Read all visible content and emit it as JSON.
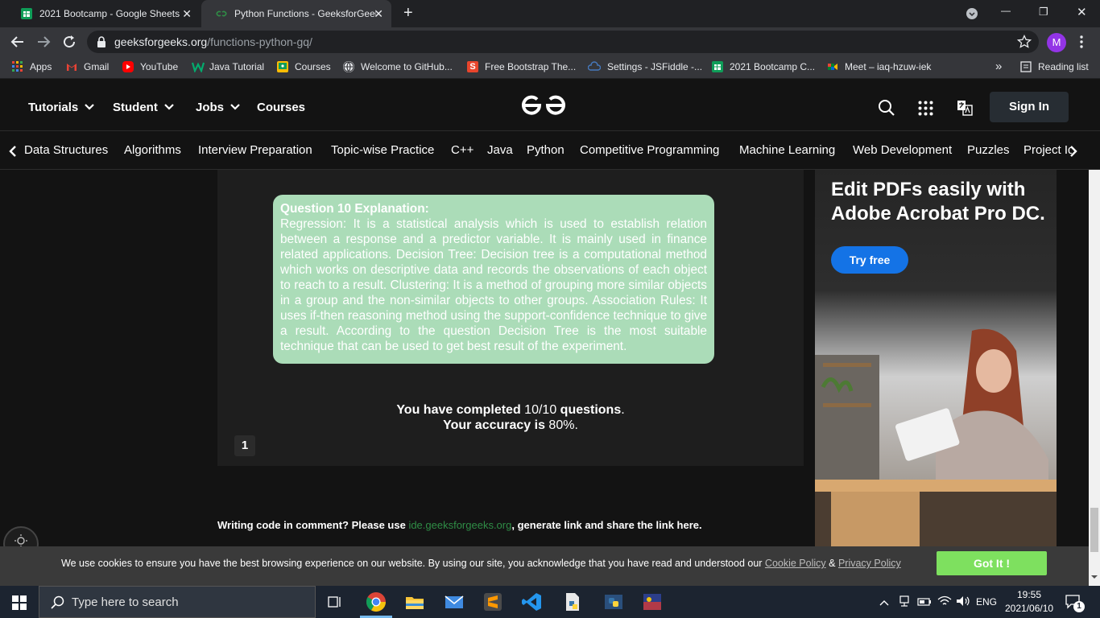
{
  "browser": {
    "tabs": [
      {
        "title": "2021 Bootcamp - Google Sheets",
        "close": "✕"
      },
      {
        "title": "Python Functions - GeeksforGeeks",
        "close": "✕"
      }
    ],
    "new_tab": "+",
    "window_controls": {
      "minimize": "—",
      "maximize": "❐",
      "close": "✕"
    },
    "url_domain": "geeksforgeeks.org",
    "url_path": "/functions-python-gq/",
    "profile_initial": "M",
    "bookmarks": [
      "Apps",
      "Gmail",
      "YouTube",
      "Java Tutorial",
      "Courses",
      "Welcome to GitHub...",
      "Free Bootstrap The...",
      "Settings - JSFiddle -...",
      "2021 Bootcamp C...",
      "Meet – iaq-hzuw-iek"
    ],
    "bookmarks_overflow": "»",
    "reading_list": "Reading list"
  },
  "site": {
    "nav": [
      "Tutorials",
      "Student",
      "Jobs",
      "Courses"
    ],
    "logo": "GG",
    "sign_in": "Sign In",
    "subnav": [
      "Data Structures",
      "Algorithms",
      "Interview Preparation",
      "Topic-wise Practice",
      "C++",
      "Java",
      "Python",
      "Competitive Programming",
      "Machine Learning",
      "Web Development",
      "Puzzles",
      "Project Ideas"
    ]
  },
  "quiz": {
    "explanation_title": "Question 10 Explanation:",
    "explanation_text": "Regression: It is a statistical analysis which is used to establish relation between a response and a predictor variable. It is mainly used in finance related applications. Decision Tree: Decision tree is a computational method which works on descriptive data and records the observations of each object to reach to a result. Clustering: It is a method of grouping more similar objects in a group and the non-similar objects to other groups. Association Rules: It uses if-then reasoning method using the support-confidence technique to give a result. According to the question Decision Tree is the most suitable technique that can be used to get best result of the experiment.",
    "completed_prefix": "You have completed ",
    "completed_count": "10/10",
    "completed_suffix": " questions",
    "completed_end": ".",
    "accuracy_prefix": "Your accuracy is ",
    "accuracy_value": "80%",
    "accuracy_end": ".",
    "page_number": "1"
  },
  "comment_note": {
    "prefix": "Writing code in comment? Please use ",
    "link": "ide.geeksforgeeks.org",
    "suffix": ", generate link and share the link here."
  },
  "ad": {
    "headline": "Edit PDFs easily with Adobe Acrobat Pro DC.",
    "cta": "Try free"
  },
  "cookie": {
    "text": "We use cookies to ensure you have the best browsing experience on our website. By using our site, you acknowledge that you have read and understood our ",
    "cookie_policy": "Cookie Policy",
    "amp": " & ",
    "privacy_policy": "Privacy Policy",
    "button": "Got It !"
  },
  "taskbar": {
    "search_placeholder": "Type here to search",
    "language": "ENG",
    "time": "19:55",
    "date": "2021/06/10",
    "notification_count": "1"
  },
  "colors": {
    "gfg_green": "#2f8d46",
    "explanation_bg": "#abdcb8",
    "cookie_button": "#7ee05f",
    "adobe_blue": "#1473e6"
  }
}
